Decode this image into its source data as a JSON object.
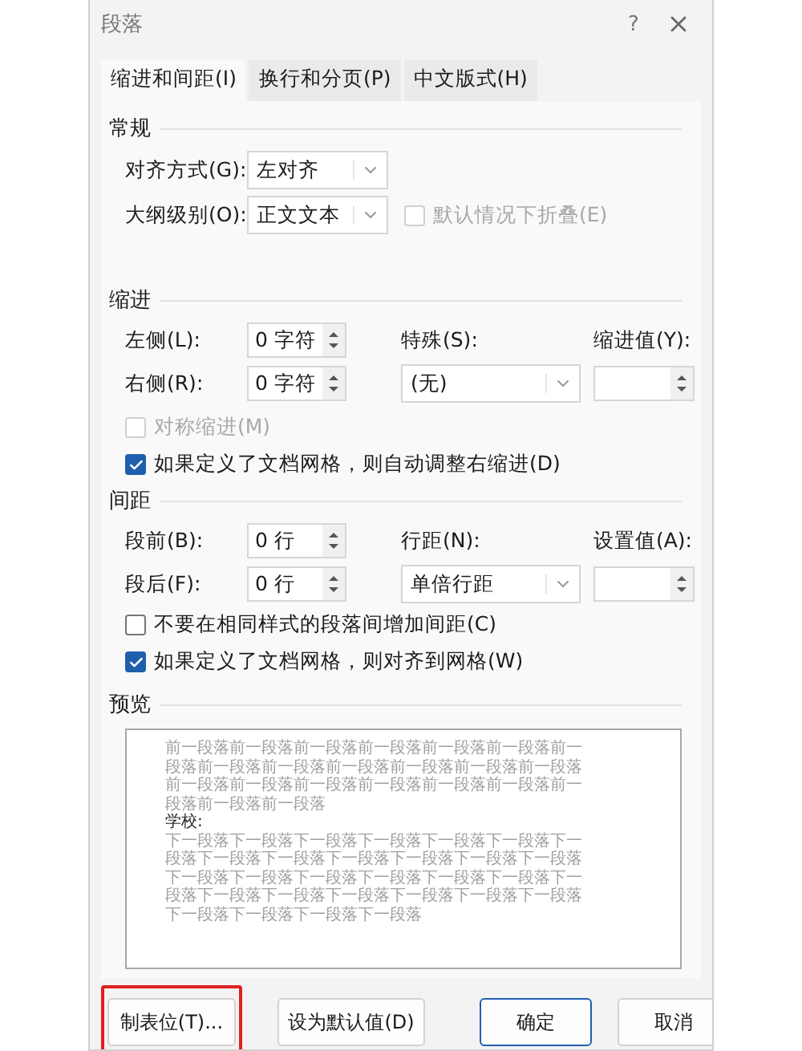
{
  "window": {
    "title": "段落",
    "help": "?"
  },
  "tabs": [
    {
      "label": "缩进和间距(I)",
      "selected": true
    },
    {
      "label": "换行和分页(P)",
      "selected": false
    },
    {
      "label": "中文版式(H)",
      "selected": false
    }
  ],
  "general": {
    "title": "常规",
    "alignment": {
      "label": "对齐方式(G):",
      "value": "左对齐"
    },
    "outline_level": {
      "label": "大纲级别(O):",
      "value": "正文文本"
    },
    "collapse": {
      "label": "默认情况下折叠(E)",
      "checked": false,
      "disabled": true
    }
  },
  "indent": {
    "title": "缩进",
    "left": {
      "label": "左侧(L):",
      "value": "0 字符"
    },
    "right": {
      "label": "右侧(R):",
      "value": "0 字符"
    },
    "special": {
      "label": "特殊(S):",
      "value": "(无)"
    },
    "by": {
      "label": "缩进值(Y):"
    },
    "checkboxes": [
      {
        "label": "对称缩进(M)",
        "checked": false,
        "disabled": true
      },
      {
        "label": "如果定义了文档网格，则自动调整右缩进(D)",
        "checked": true,
        "disabled": false
      }
    ]
  },
  "spacing": {
    "title": "间距",
    "before": {
      "label": "段前(B):",
      "value": "0 行"
    },
    "after": {
      "label": "段后(F):",
      "value": "0 行"
    },
    "line_spacing": {
      "label": "行距(N):",
      "value": "单倍行距"
    },
    "at": {
      "label": "设置值(A):"
    },
    "checkboxes": [
      {
        "label": "不要在相同样式的段落间增加间距(C)",
        "checked": false,
        "disabled": false
      },
      {
        "label": "如果定义了文档网格，则对齐到网格(W)",
        "checked": true,
        "disabled": false
      }
    ]
  },
  "preview": {
    "title": "预览",
    "previous_text": "前一段落前一段落前一段落前一段落前一段落前一段落前一段落前一段落前一段落前一段落前一段落前一段落前一段落前一段落前一段落前一段落前一段落前一段落前一段落前一段落前一段落前一段落",
    "sample_text": "学校:",
    "next_text": "下一段落下一段落下一段落下一段落下一段落下一段落下一段落下一段落下一段落下一段落下一段落下一段落下一段落下一段落下一段落下一段落下一段落下一段落下一段落下一段落下一段落下一段落下一段落下一段落下一段落下一段落下一段落下一段落下一段落下一段落"
  },
  "buttons": [
    {
      "label": "制表位(T)...",
      "highlighted": true,
      "default": false
    },
    {
      "label": "设为默认值(D)",
      "highlighted": false,
      "default": false
    },
    {
      "label": "确定",
      "highlighted": false,
      "default": true
    },
    {
      "label": "取消",
      "highlighted": false,
      "default": false
    }
  ]
}
